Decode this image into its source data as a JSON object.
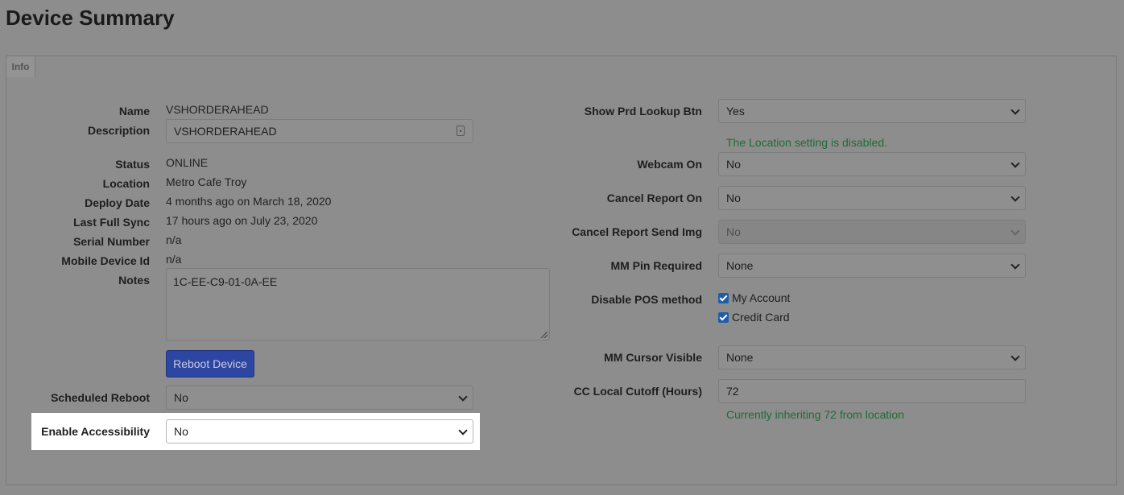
{
  "page_title": "Device Summary",
  "tabs": {
    "info": "Info"
  },
  "left": {
    "name": {
      "label": "Name",
      "value": "VSHORDERAHEAD"
    },
    "description": {
      "label": "Description",
      "value": "VSHORDERAHEAD"
    },
    "status": {
      "label": "Status",
      "value": "ONLINE"
    },
    "location": {
      "label": "Location",
      "value": "Metro Cafe Troy"
    },
    "deploy_date": {
      "label": "Deploy Date",
      "value": "4 months ago on March 18, 2020"
    },
    "last_full_sync": {
      "label": "Last Full Sync",
      "value": "17 hours ago on July 23, 2020"
    },
    "serial_number": {
      "label": "Serial Number",
      "value": "n/a"
    },
    "mobile_device_id": {
      "label": "Mobile Device Id",
      "value": "n/a"
    },
    "notes": {
      "label": "Notes",
      "value": "1C-EE-C9-01-0A-EE"
    },
    "reboot_button": "Reboot Device",
    "scheduled_reboot": {
      "label": "Scheduled Reboot",
      "value": "No"
    },
    "enable_accessibility": {
      "label": "Enable Accessibility",
      "value": "No"
    }
  },
  "right": {
    "show_prd_lookup_btn": {
      "label": "Show Prd Lookup Btn",
      "value": "Yes"
    },
    "location_note": "The Location setting is disabled.",
    "webcam_on": {
      "label": "Webcam On",
      "value": "No"
    },
    "cancel_report_on": {
      "label": "Cancel Report On",
      "value": "No"
    },
    "cancel_report_send_img": {
      "label": "Cancel Report Send Img",
      "value": "No"
    },
    "mm_pin_required": {
      "label": "MM Pin Required",
      "value": "None"
    },
    "disable_pos_method": {
      "label": "Disable POS method",
      "options": [
        "My Account",
        "Credit Card"
      ]
    },
    "mm_cursor_visible": {
      "label": "MM Cursor Visible",
      "value": "None"
    },
    "cc_local_cutoff": {
      "label": "CC Local Cutoff (Hours)",
      "value": "72"
    },
    "cutoff_note": "Currently inheriting 72 from location"
  },
  "icons": {
    "description_field": "lock-icon"
  },
  "colors": {
    "primary_button": "#2d46a1",
    "success_text": "#1f6b34",
    "checkbox": "#1f5da8",
    "overlay": "#8d8d8d"
  }
}
